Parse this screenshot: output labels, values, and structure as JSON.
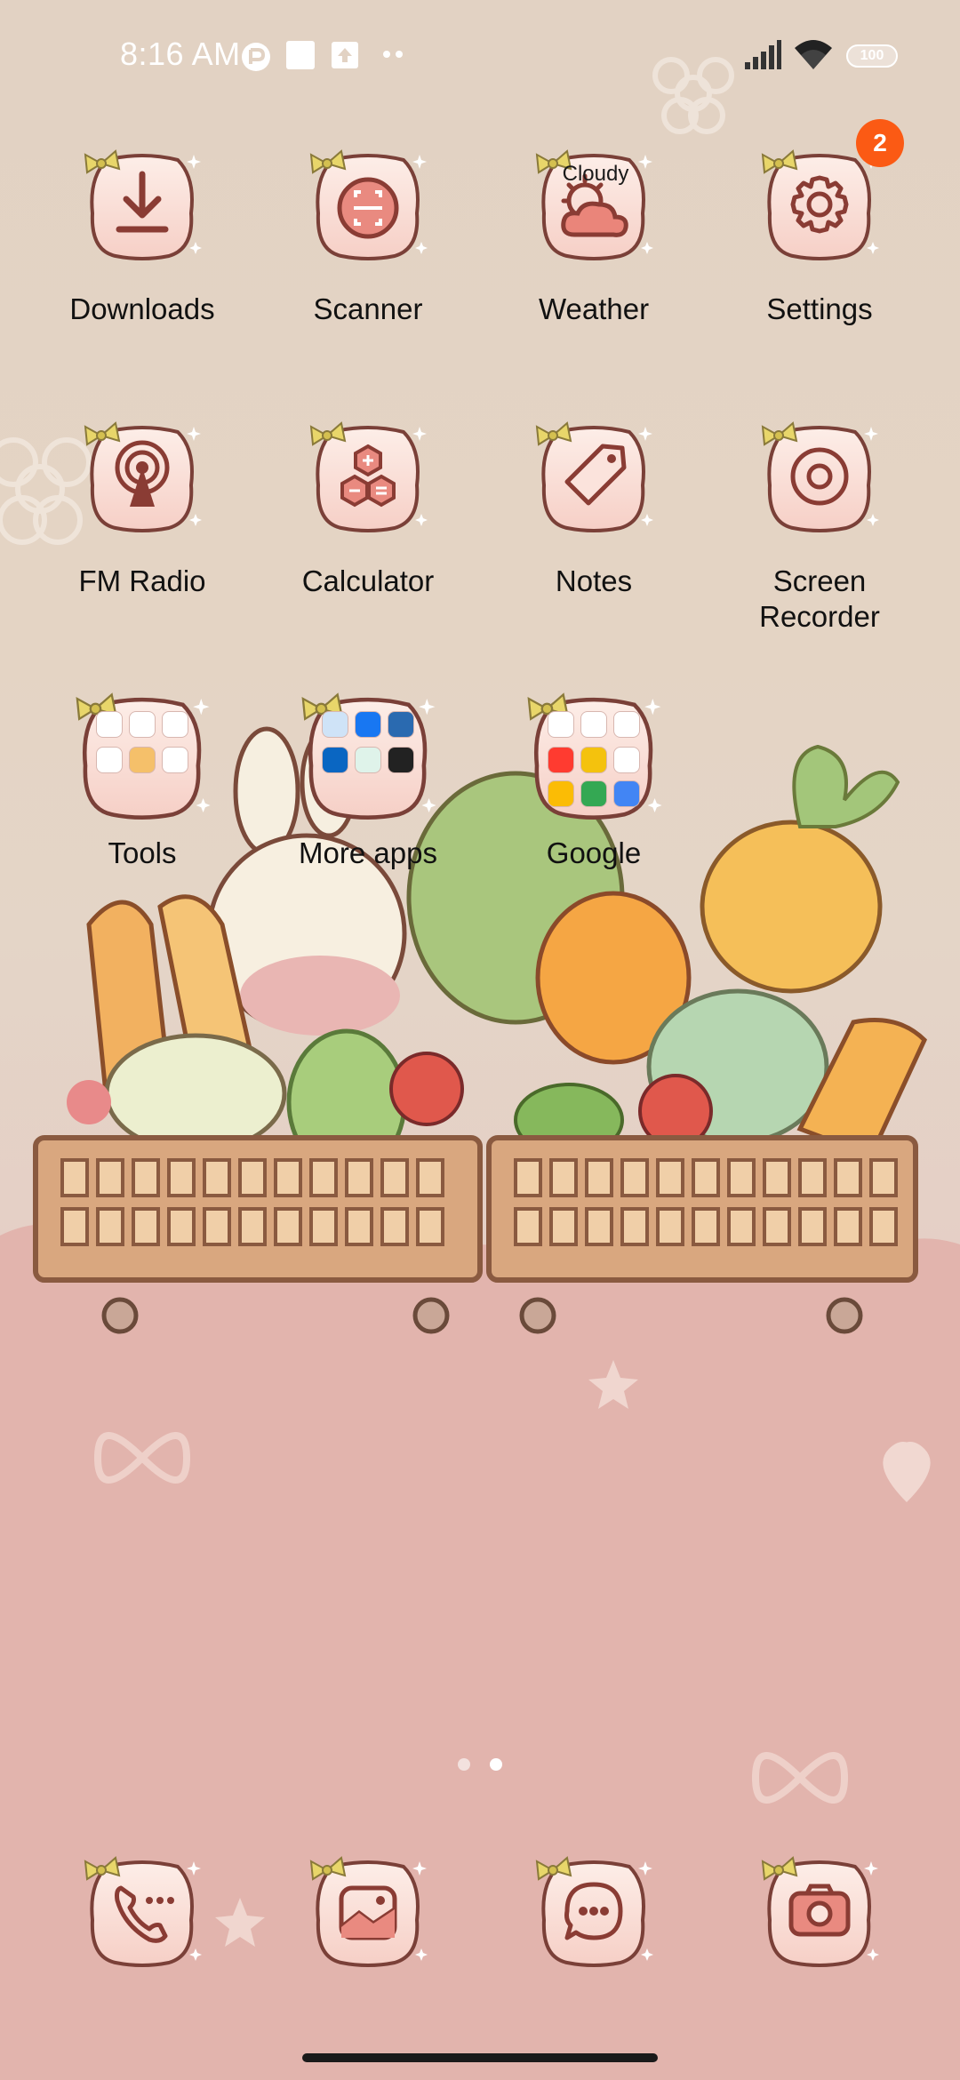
{
  "status_bar": {
    "time": "8:16 AM",
    "battery": "100",
    "icons": [
      "app-status-icon",
      "square-notification-icon",
      "upload-notification-icon",
      "more-dots-icon",
      "signal-icon",
      "wifi-icon",
      "battery-icon"
    ]
  },
  "home": {
    "row1": [
      {
        "label": "Downloads",
        "icon": "download-icon"
      },
      {
        "label": "Scanner",
        "icon": "scanner-icon"
      },
      {
        "label": "Weather",
        "icon": "weather-icon",
        "widget_text": "Cloudy"
      },
      {
        "label": "Settings",
        "icon": "gear-icon",
        "badge": "2"
      }
    ],
    "row2": [
      {
        "label": "FM Radio",
        "icon": "radio-icon"
      },
      {
        "label": "Calculator",
        "icon": "calculator-icon"
      },
      {
        "label": "Notes",
        "icon": "tag-icon"
      },
      {
        "label": "Screen Recorder",
        "icon": "record-icon"
      }
    ],
    "folders": [
      {
        "label": "Tools"
      },
      {
        "label": "More apps"
      },
      {
        "label": "Google"
      }
    ]
  },
  "page_indicator": {
    "pages": 2,
    "current": 2
  },
  "dock": [
    {
      "name": "Phone",
      "icon": "phone-icon"
    },
    {
      "name": "Gallery",
      "icon": "gallery-icon"
    },
    {
      "name": "Messages",
      "icon": "messages-icon"
    },
    {
      "name": "Camera",
      "icon": "camera-icon"
    }
  ],
  "colors": {
    "icon_bg": "#fbe3dc",
    "icon_outline": "#7a4038",
    "glyph": "#8a3c34",
    "badge": "#fb5a14",
    "bow": "#e8d66a"
  }
}
